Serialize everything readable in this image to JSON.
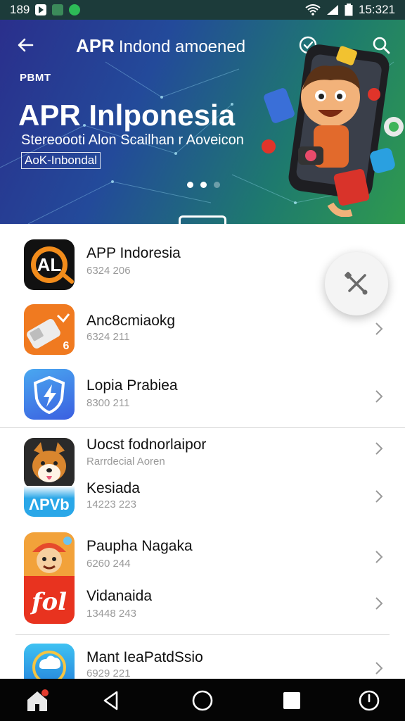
{
  "status_bar": {
    "time_left": "189",
    "time_right": "15:321",
    "colors": {
      "background": "#1c3b3a"
    }
  },
  "hero": {
    "topbar_title_bold": "APR",
    "topbar_title_rest": "Indond amoened",
    "eyebrow": "PBMT",
    "title": "APR Inlponesia",
    "subtitle": "Stereoooti Alon Scailhan r Aoveicon",
    "tag": "AoK-Inbondal",
    "dots": 3,
    "active_dot": 0,
    "colors": {
      "gradient_start": "#2a2f8c",
      "gradient_end": "#2f9a4e"
    }
  },
  "apps": [
    {
      "name": "APP Indoresia",
      "meta": "6324 206",
      "icon": "al-logo-icon",
      "colors": {
        "bg": "#111111",
        "accent": "#f28c1b"
      }
    },
    {
      "name": "Anc8cmiaokg",
      "meta": "6324 211",
      "icon": "usb-drive-icon",
      "colors": {
        "bg": "#f07a20",
        "accent": "#ffffff"
      }
    },
    {
      "name": "Lopia Prabiea",
      "meta": "8300 211",
      "icon": "shield-bolt-icon",
      "colors": {
        "bg": "#3b7fe0",
        "accent": "#ffffff"
      }
    },
    {
      "name": "Uocst fodnorlaipor",
      "meta": "Rarrdecial Aoren",
      "icon": "shiba-dog-icon",
      "colors": {
        "bg": "#f3d9b0",
        "accent": "#d9862e"
      }
    },
    {
      "name": "Kesiada",
      "meta": "14223 223",
      "icon": "blue-badge-icon",
      "colors": {
        "bg": "#2aa7e8",
        "accent": "#ffffff"
      }
    },
    {
      "name": "Paupha Nagaka",
      "meta": "6260 244",
      "icon": "cartoon-worker-icon",
      "colors": {
        "bg": "#f2a23a",
        "accent": "#e64a2b"
      }
    },
    {
      "name": "Vidanaida",
      "meta": "13448 243",
      "icon": "fol-logo-icon",
      "colors": {
        "bg": "#e8331f",
        "accent": "#ffffff"
      }
    },
    {
      "name": "Mant IeaPatdSsio",
      "meta": "6929 221",
      "icon": "cloud-globe-icon",
      "colors": {
        "bg": "#2ab4e8",
        "accent": "#f5c542"
      }
    }
  ],
  "fab": {
    "icon": "tools-icon"
  },
  "nav_bar": {
    "items": [
      "home-icon",
      "back-triangle-icon",
      "home-circle-icon",
      "recents-square-icon",
      "power-icon"
    ]
  }
}
